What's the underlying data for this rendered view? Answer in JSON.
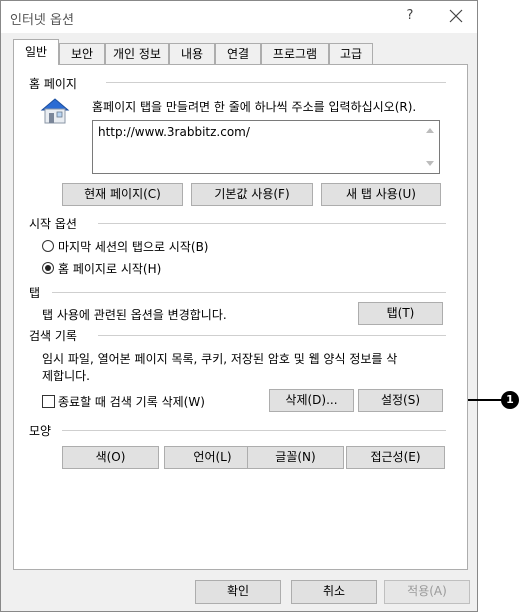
{
  "window": {
    "title": "인터넷 옵션",
    "help_label": "?"
  },
  "tabs": [
    {
      "label": "일반",
      "active": true
    },
    {
      "label": "보안"
    },
    {
      "label": "개인 정보"
    },
    {
      "label": "내용"
    },
    {
      "label": "연결"
    },
    {
      "label": "프로그램"
    },
    {
      "label": "고급"
    }
  ],
  "home_page": {
    "title": "홈 페이지",
    "instruction": "홈페이지 탭을 만들려면 한 줄에 하나씩 주소를 입력하십시오(R).",
    "url": "http://www.3rabbitz.com/",
    "icon": "house-icon",
    "buttons": {
      "current": "현재 페이지(C)",
      "default": "기본값 사용(F)",
      "new_tab": "새 탭 사용(U)"
    }
  },
  "startup": {
    "title": "시작 옵션",
    "options": [
      {
        "label": "마지막 세션의 탭으로 시작(B)",
        "selected": false
      },
      {
        "label": "홈 페이지로 시작(H)",
        "selected": true
      }
    ]
  },
  "tabs_section": {
    "title": "탭",
    "description": "탭 사용에 관련된 옵션을 변경합니다.",
    "button": "탭(T)"
  },
  "history": {
    "title": "검색 기록",
    "description_line1": "임시 파일, 열어본 페이지 목록, 쿠키, 저장된 암호 및 웹 양식 정보를 삭",
    "description_line2": "제합니다.",
    "checkbox_label": "종료할 때 검색 기록 삭제(W)",
    "checkbox_checked": false,
    "delete_button": "삭제(D)...",
    "settings_button": "설정(S)"
  },
  "appearance": {
    "title": "모양",
    "buttons": {
      "colors": "색(O)",
      "languages": "언어(L)",
      "fonts": "글꼴(N)",
      "accessibility": "접근성(E)"
    }
  },
  "footer": {
    "ok": "확인",
    "cancel": "취소",
    "apply": "적용(A)"
  },
  "callout": {
    "number": "1"
  }
}
